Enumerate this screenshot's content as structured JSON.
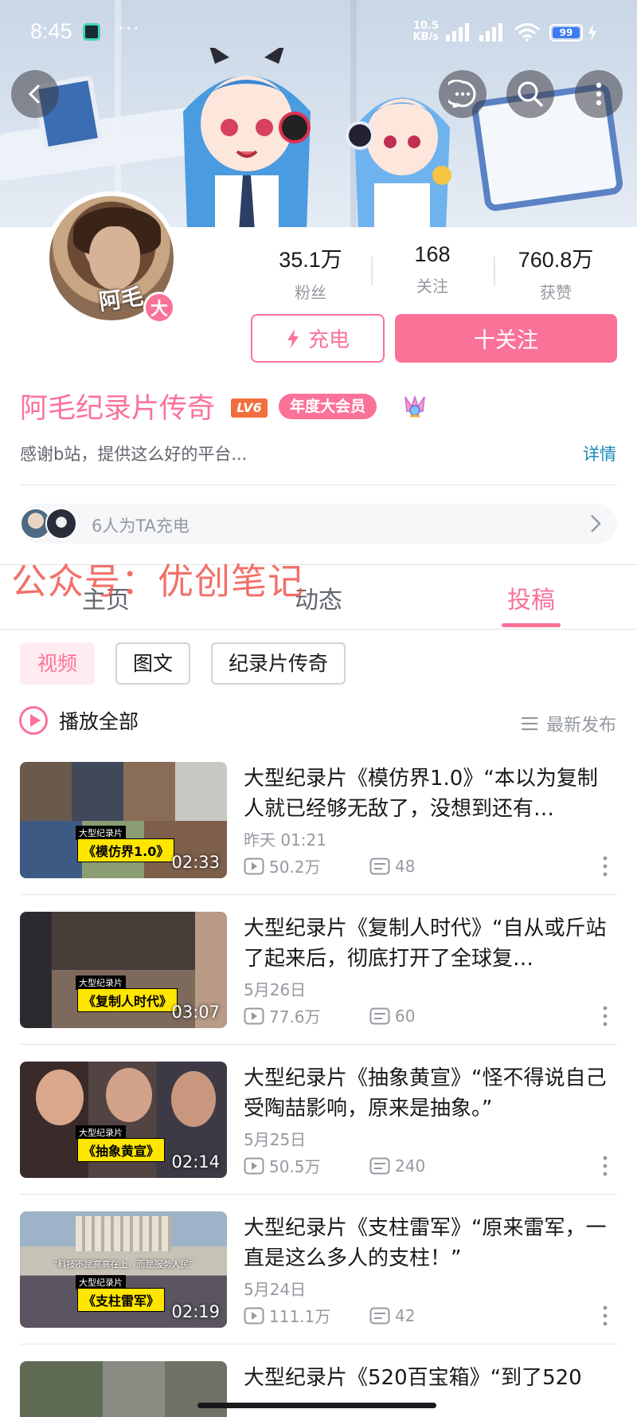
{
  "status_bar": {
    "time": "8:45",
    "dots": "···",
    "net_speed_value": "10.5",
    "net_speed_unit": "KB/s",
    "battery": "99"
  },
  "profile": {
    "avatar_signature": "阿毛",
    "avatar_badge": "大",
    "stats": [
      {
        "value": "35.1万",
        "label": "粉丝"
      },
      {
        "value": "168",
        "label": "关注"
      },
      {
        "value": "760.8万",
        "label": "获赞"
      }
    ],
    "charge_button": "充电",
    "follow_button": "十关注",
    "name": "阿毛纪录片传奇",
    "level": "LV6",
    "vip_badge": "年度大会员",
    "bio": "感谢b站，提供这么好的平台...",
    "bio_more": "详情",
    "charge_count_text": "6人为TA充电"
  },
  "watermark": "公众号：优创笔记",
  "tabs": [
    {
      "label": "主页",
      "active": false
    },
    {
      "label": "动态",
      "active": false
    },
    {
      "label": "投稿",
      "active": true
    }
  ],
  "filters": [
    {
      "label": "视频",
      "active": true
    },
    {
      "label": "图文",
      "active": false
    },
    {
      "label": "纪录片传奇",
      "active": false
    }
  ],
  "play_all": "播放全部",
  "sort_label": "最新发布",
  "videos": [
    {
      "title": "大型纪录片《模仿界1.0》“本以为复制人就已经够无敌了，没想到还有…",
      "date": "昨天 01:21",
      "views": "50.2万",
      "danmaku": "48",
      "duration": "02:33",
      "thumb_caption": "《模仿界1.0》",
      "thumb_small": "大型纪录片"
    },
    {
      "title": "大型纪录片《复制人时代》“自从或斤站了起来后，彻底打开了全球复…",
      "date": "5月26日",
      "views": "77.6万",
      "danmaku": "60",
      "duration": "03:07",
      "thumb_caption": "《复制人时代》",
      "thumb_small": "大型纪录片"
    },
    {
      "title": "大型纪录片《抽象黄宣》“怪不得说自己受陶喆影响，原来是抽象。”",
      "date": "5月25日",
      "views": "50.5万",
      "danmaku": "240",
      "duration": "02:14",
      "thumb_caption": "《抽象黄宣》",
      "thumb_small": "大型纪录片"
    },
    {
      "title": "大型纪录片《支柱雷军》“原来雷军，一直是这么多人的支柱！”",
      "date": "5月24日",
      "views": "111.1万",
      "danmaku": "42",
      "duration": "02:19",
      "thumb_caption": "《支柱雷军》",
      "thumb_small": "大型纪录片",
      "thumb_banner": "“科技不是高高在上，而是服务人民”"
    },
    {
      "title": "大型纪录片《520百宝箱》“到了520",
      "date": "",
      "views": "",
      "danmaku": "",
      "duration": "",
      "thumb_caption": "",
      "thumb_small": ""
    }
  ],
  "colors": {
    "accent": "#fb7299",
    "link": "#178bb8",
    "watermark": "#f0584f",
    "secondary_text": "#9499a0"
  }
}
